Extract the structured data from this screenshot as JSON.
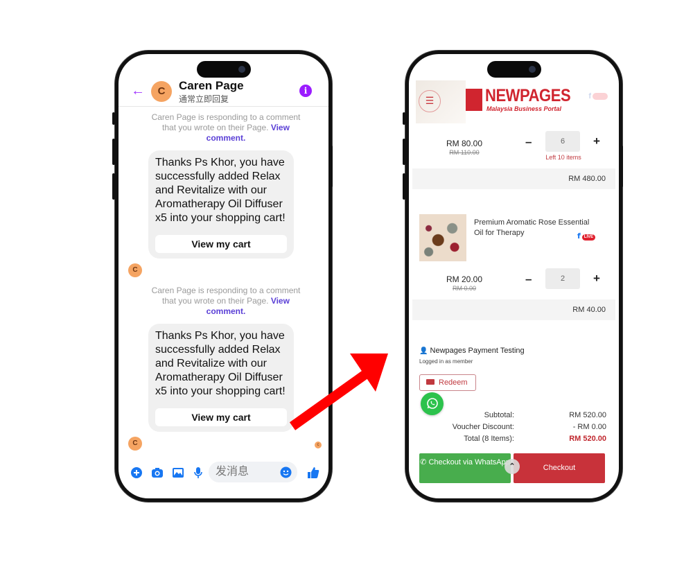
{
  "messenger": {
    "contact_name": "Caren Page",
    "contact_status": "通常立即回复",
    "avatar_letter": "C",
    "messages": [
      {
        "note_prefix": "Caren Page is responding to a comment that you wrote on their Page.",
        "note_link": "View comment.",
        "text": "Thanks Ps Khor, you have successfully added Relax and Revitalize with our Aromatherapy Oil Diffuser x5 into your shopping cart!",
        "button_label": "View my cart"
      },
      {
        "note_prefix": "Caren Page is responding to a comment that you wrote on their Page.",
        "note_link": "View comment.",
        "text": "Thanks Ps Khor, you have successfully added Relax and Revitalize with our Aromatherapy Oil Diffuser x5 into your shopping cart!",
        "button_label": "View my cart"
      }
    ],
    "compose_placeholder": "发消息",
    "icons": [
      "back-arrow-icon",
      "info-icon",
      "plus-icon",
      "camera-icon",
      "image-icon",
      "microphone-icon",
      "emoji-icon",
      "thumbs-up-icon"
    ],
    "accent_color": "#a033ff",
    "action_color": "#1877f2"
  },
  "cart": {
    "brand": "NEWPAGES",
    "brand_tagline": "Malaysia Business Portal",
    "brand_color": "#d0252f",
    "items": [
      {
        "name": "",
        "price": "RM 80.00",
        "original_price": "RM 110.00",
        "quantity": "6",
        "stock_note": "Left 10 items",
        "line_total": "RM 480.00"
      },
      {
        "name": "Premium Aromatic Rose Essential Oil for Therapy",
        "source_badge": "LIVE",
        "price": "RM 20.00",
        "original_price": "RM 0.00",
        "quantity": "2",
        "line_total": "RM 40.00"
      }
    ],
    "member": {
      "name": "Newpages Payment Testing",
      "status": "Logged in as member"
    },
    "redeem_label": "Redeem",
    "summary": {
      "subtotal_label": "Subtotal:",
      "subtotal": "RM 520.00",
      "discount_label": "Voucher Discount:",
      "discount": "- RM 0.00",
      "total_label": "Total (8 Items):",
      "total": "RM 520.00"
    },
    "whatsapp_checkout_label": "Checkout via WhatsApp",
    "checkout_label": "Checkout",
    "whatsapp_color": "#48ad4d",
    "checkout_color": "#c8323a"
  }
}
